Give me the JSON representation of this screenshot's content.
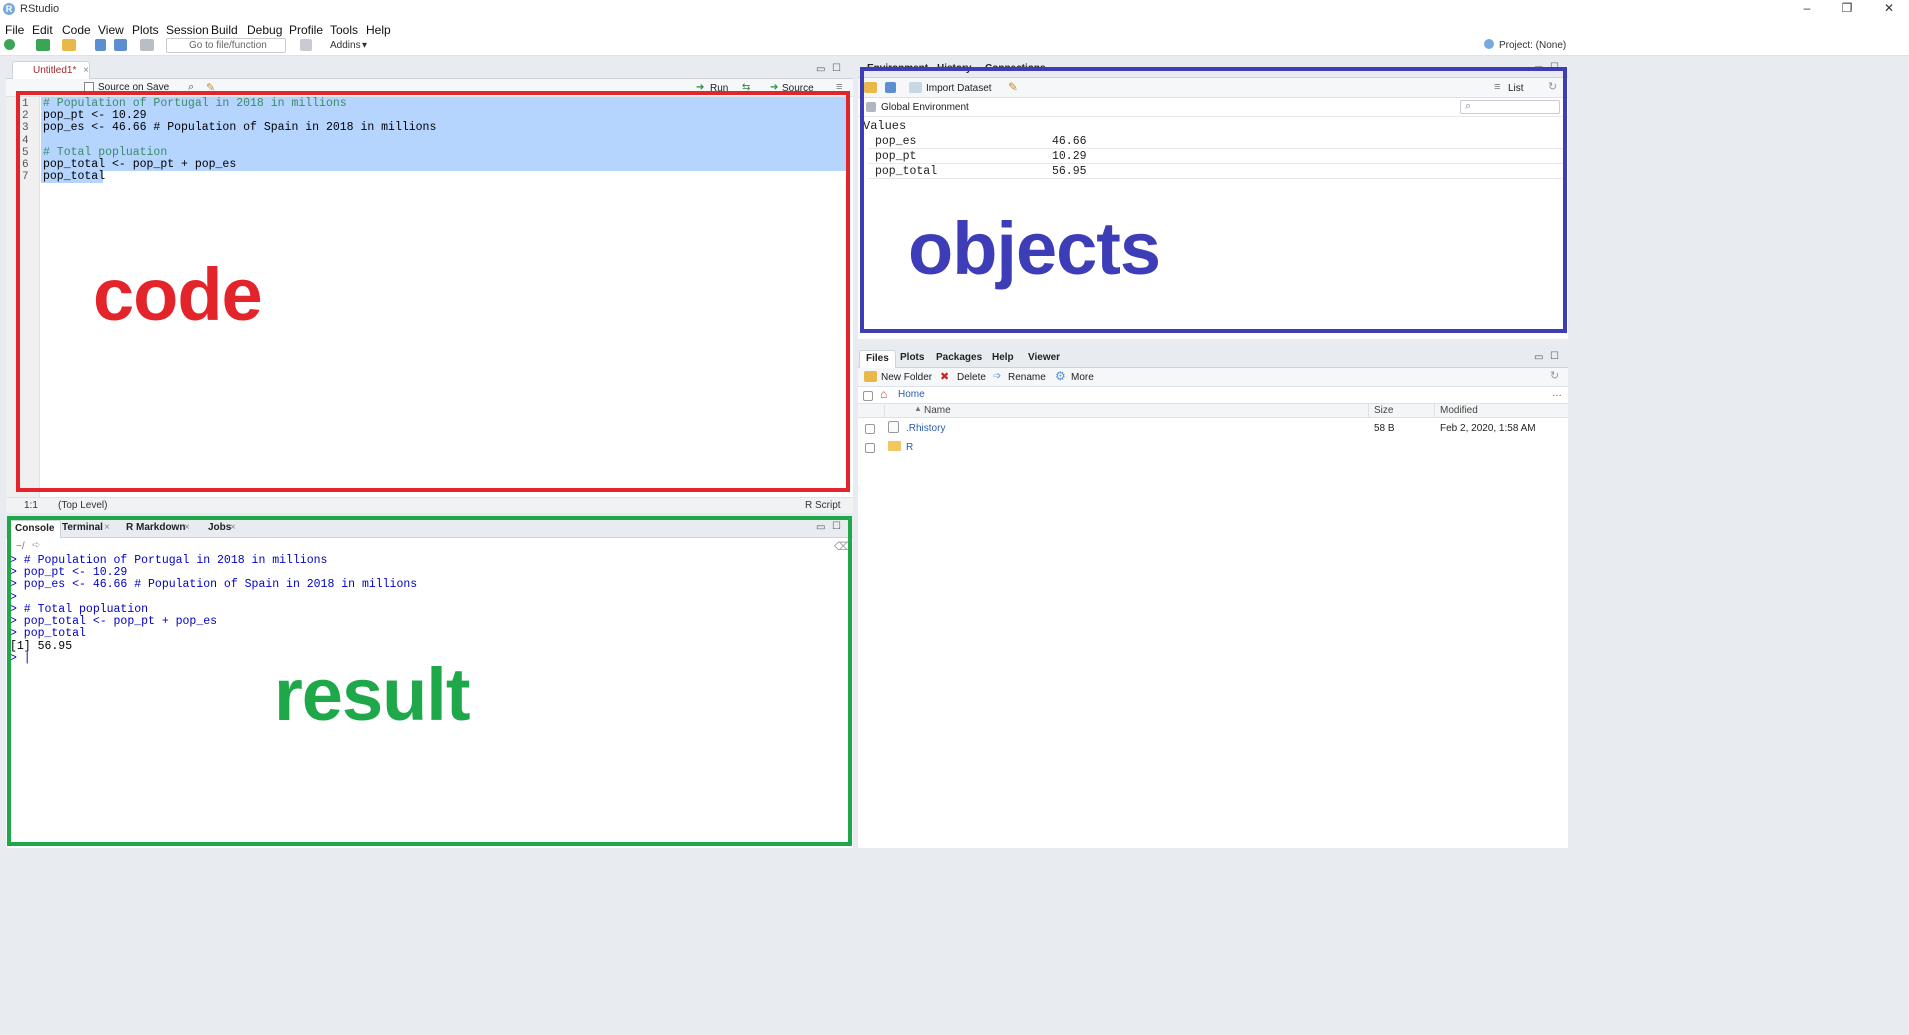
{
  "window": {
    "title": "RStudio",
    "controls": [
      "–",
      "❐",
      "✕"
    ]
  },
  "menu": [
    "File",
    "Edit",
    "Code",
    "View",
    "Plots",
    "Session",
    "Build",
    "Debug",
    "Profile",
    "Tools",
    "Help"
  ],
  "toolbar": {
    "goto_placeholder": "Go to file/function",
    "addins_label": "Addins",
    "project_label": "Project: (None)"
  },
  "editor": {
    "tab_label": "Untitled1*",
    "source_on_save_label": "Source on Save",
    "run_label": "Run",
    "source_label": "Source",
    "line_numbers": [
      "1",
      "2",
      "3",
      "4",
      "5",
      "6",
      "7"
    ],
    "code_lines": [
      "# Population of Portugal in 2018 in millions",
      "pop_pt <- 10.29",
      "pop_es <- 46.66 # Population of Spain in 2018 in millions",
      "",
      "# Total popluation",
      "pop_total <- pop_pt + pop_es",
      "pop_total"
    ],
    "status_position": "1:1",
    "status_scope": "(Top Level)",
    "status_type": "R Script"
  },
  "console": {
    "tabs": [
      "Console",
      "Terminal",
      "R Markdown",
      "Jobs"
    ],
    "working_dir": "~/",
    "lines": [
      "> # Population of Portugal in 2018 in millions",
      "> pop_pt <- 10.29",
      "> pop_es <- 46.66 # Population of Spain in 2018 in millions",
      ">",
      "> # Total popluation",
      "> pop_total <- pop_pt + pop_es",
      "> pop_total",
      "[1] 56.95",
      "> |"
    ]
  },
  "environment": {
    "tabs": [
      "Environment",
      "History",
      "Connections"
    ],
    "import_label": "Import Dataset",
    "list_label": "List",
    "scope_label": "Global Environment",
    "section_label": "Values",
    "rows": [
      {
        "name": "pop_es",
        "value": "46.66"
      },
      {
        "name": "pop_pt",
        "value": "10.29"
      },
      {
        "name": "pop_total",
        "value": "56.95"
      }
    ]
  },
  "files": {
    "tabs": [
      "Files",
      "Plots",
      "Packages",
      "Help",
      "Viewer"
    ],
    "new_folder_label": "New Folder",
    "delete_label": "Delete",
    "rename_label": "Rename",
    "more_label": "More",
    "crumb": "Home",
    "col_name": "Name",
    "col_size": "Size",
    "col_modified": "Modified",
    "rows": [
      {
        "name": ".Rhistory",
        "size": "58 B",
        "modified": "Feb 2, 2020, 1:58 AM"
      },
      {
        "name": "R",
        "size": "",
        "modified": ""
      }
    ]
  },
  "annotations": {
    "code": {
      "label": "code",
      "color": "#e3242b"
    },
    "objects": {
      "label": "objects",
      "color": "#3d3db8"
    },
    "result": {
      "label": "result",
      "color": "#1fa84a"
    }
  }
}
